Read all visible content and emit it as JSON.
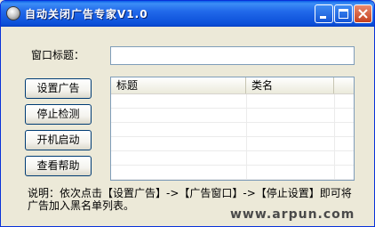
{
  "window": {
    "title": "自动关闭广告专家V1.0",
    "controls": {
      "minimize": "minimize-icon",
      "maximize": "maximize-icon",
      "close": "close-icon"
    }
  },
  "form": {
    "window_title_label": "窗口标题：",
    "window_title_value": ""
  },
  "buttons": {
    "set_ad": "设置广告",
    "stop_detect": "停止检测",
    "auto_start": "开机启动",
    "view_help": "查看帮助"
  },
  "list": {
    "columns": [
      "标题",
      "类名"
    ],
    "rows": []
  },
  "note": "说明：依次点击【设置广告】->【广告窗口】->【停止设置】即可将广告加入黑名单列表。",
  "brand": "www.arpun.com"
}
